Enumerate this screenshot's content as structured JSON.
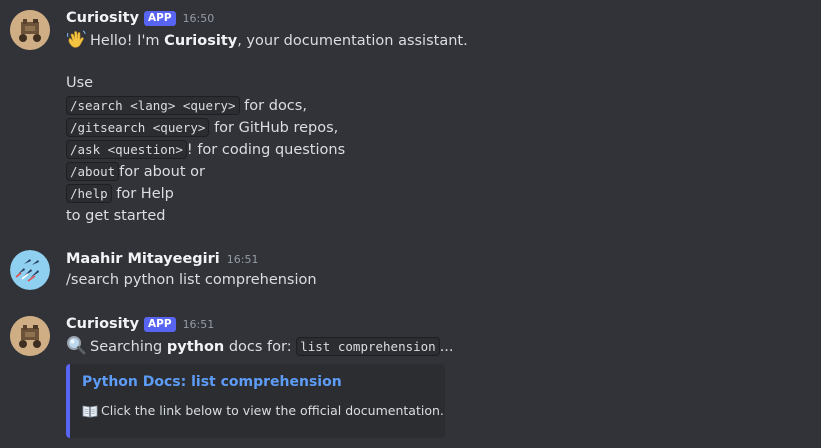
{
  "messages": [
    {
      "author": "Curiosity",
      "badge": "APP",
      "time": "16:50",
      "avatar": "curiosity-rover-avatar",
      "greeting_pre": "Hello! I'm ",
      "greeting_bold": "Curiosity",
      "greeting_post": ", your documentation assistant.",
      "use_label": "Use",
      "commands": [
        {
          "code": "/search <lang> <query>",
          "text": " for docs,"
        },
        {
          "code": "/gitsearch <query>",
          "text": " for GitHub repos,"
        },
        {
          "code": "/ask <question>",
          "text": "! for coding questions"
        },
        {
          "code": "/about",
          "text": "for about or"
        },
        {
          "code": "/help",
          "text": " for Help"
        }
      ],
      "closing": "to get started"
    },
    {
      "author": "Maahir Mitayeegiri",
      "time": "16:51",
      "avatar": "jets-avatar",
      "text": "/search python list comprehension"
    },
    {
      "author": "Curiosity",
      "badge": "APP",
      "time": "16:51",
      "avatar": "curiosity-rover-avatar",
      "searching_pre": "Searching ",
      "searching_bold": "python",
      "searching_mid": " docs for: ",
      "searching_code": "list comprehension",
      "searching_post": "...",
      "embed": {
        "title": "Python Docs: list comprehension",
        "description": "Click the link below to view the official documentation.",
        "accent_color": "#5865f2",
        "icon": "open-book-icon"
      }
    }
  ],
  "colors": {
    "background": "#313338",
    "app_badge": "#5865f2",
    "link": "#5d9cf7",
    "code_bg": "#2b2d31"
  }
}
